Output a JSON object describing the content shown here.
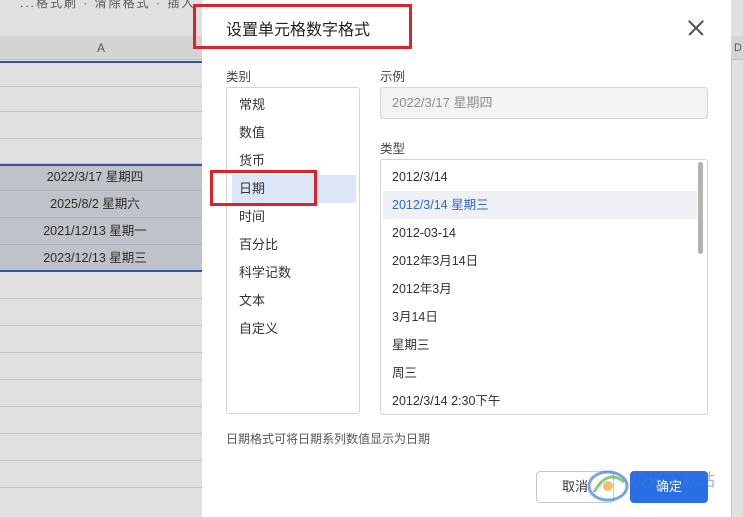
{
  "sheet": {
    "topbar_text": "...格式刷 · 清除格式 · 插入",
    "column_a_header": "A",
    "column_d_header": "D",
    "cells": [
      "2022/3/17 星期四",
      "2025/8/2 星期六",
      "2021/12/13 星期一",
      "2023/12/13 星期三"
    ]
  },
  "dialog": {
    "title": "设置单元格数字格式",
    "category_label": "类别",
    "categories": [
      "常规",
      "数值",
      "货币",
      "日期",
      "时间",
      "百分比",
      "科学记数",
      "文本",
      "自定义"
    ],
    "selected_category": "日期",
    "sample_label": "示例",
    "sample_value": "2022/3/17 星期四",
    "type_label": "类型",
    "types": [
      "2012/3/14",
      "2012/3/14 星期三",
      "2012-03-14",
      "2012年3月14日",
      "2012年3月",
      "3月14日",
      "星期三",
      "周三",
      "2012/3/14 2:30下午"
    ],
    "selected_type": "2012/3/14 星期三",
    "hint": "日期格式可将日期系列数值显示为日期",
    "cancel_label": "取消",
    "ok_label": "确定"
  },
  "colors": {
    "accent": "#2a6ee6",
    "highlight_box": "#d9232d",
    "selected_type_text": "#3569c4"
  },
  "watermark": {
    "text": "极光下载站"
  }
}
